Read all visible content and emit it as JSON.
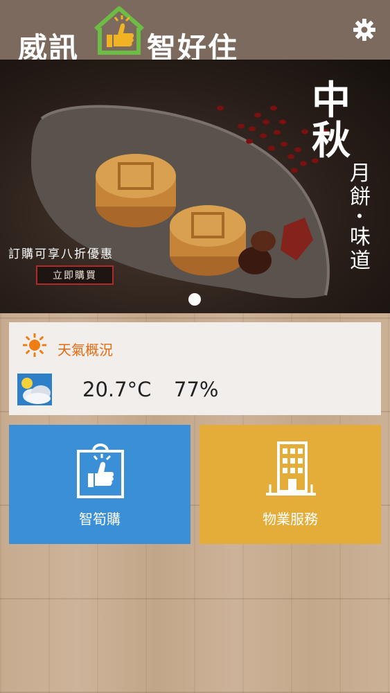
{
  "header": {
    "logo_left": "威訊",
    "logo_right": "智好住"
  },
  "banner": {
    "promo": "訂購可享八折優惠",
    "buy_button": "立即購買",
    "title_big": "中秋",
    "title_line1": "月餅",
    "title_dot": "・",
    "title_line2": "味道"
  },
  "weather": {
    "title": "天氣概況",
    "temperature": "20.7°C",
    "humidity": "77%"
  },
  "tiles": {
    "shop": "智筍購",
    "property": "物業服務"
  },
  "colors": {
    "header": "#7b6a5d",
    "weather_title": "#e36b11",
    "shop_tile": "#3a8fd6",
    "property_tile": "#e4ad3a"
  }
}
